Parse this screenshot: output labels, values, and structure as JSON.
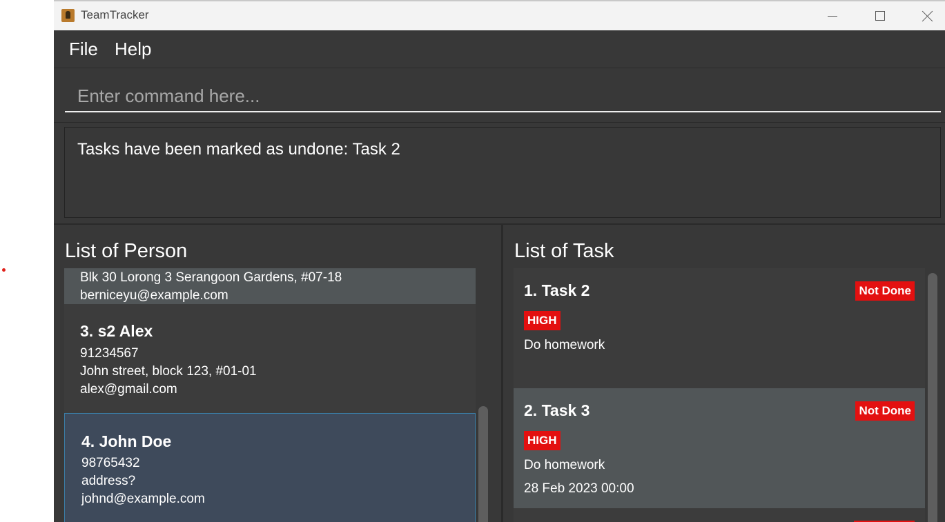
{
  "window": {
    "title": "TeamTracker"
  },
  "menu": {
    "items": [
      "File",
      "Help"
    ]
  },
  "command": {
    "placeholder": "Enter command here...",
    "value": ""
  },
  "result": {
    "message": "Tasks have been marked as undone: Task 2"
  },
  "person_panel": {
    "title": "List of Person",
    "cards": [
      {
        "address": "Blk 30 Lorong 3 Serangoon Gardens, #07-18",
        "email": "berniceyu@example.com"
      },
      {
        "name": "3.  s2 Alex",
        "phone": "91234567",
        "address": "John street, block 123, #01-01",
        "email": "alex@gmail.com"
      },
      {
        "name": "4.  John Doe",
        "phone": "98765432",
        "address": "address?",
        "email": "johnd@example.com"
      }
    ]
  },
  "task_panel": {
    "title": "List of Task",
    "tasks": [
      {
        "title": "1. Task 2",
        "status": "Not Done",
        "priority": "HIGH",
        "description": "Do homework",
        "deadline": ""
      },
      {
        "title": "2. Task 3",
        "status": "Not Done",
        "priority": "HIGH",
        "description": "Do homework",
        "deadline": "28 Feb 2023 00:00"
      }
    ]
  },
  "colors": {
    "background": "#383838",
    "badge_red": "#e31010",
    "selected_card": "#3e4a5b",
    "alt_card": "#515658"
  }
}
